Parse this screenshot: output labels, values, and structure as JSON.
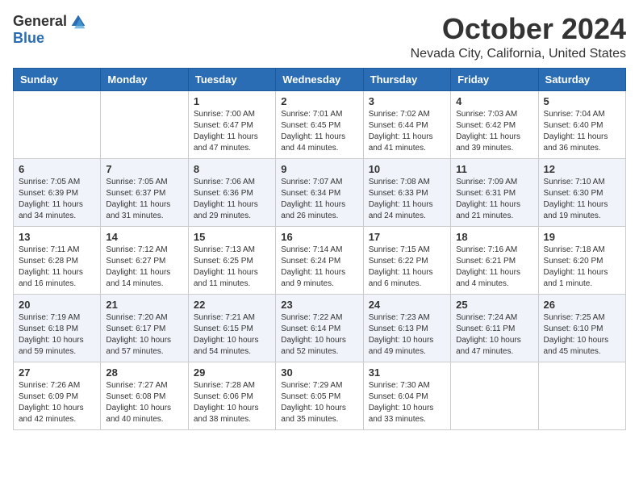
{
  "header": {
    "logo_general": "General",
    "logo_blue": "Blue",
    "month_title": "October 2024",
    "location": "Nevada City, California, United States"
  },
  "days_of_week": [
    "Sunday",
    "Monday",
    "Tuesday",
    "Wednesday",
    "Thursday",
    "Friday",
    "Saturday"
  ],
  "weeks": [
    [
      {
        "day": "",
        "info": ""
      },
      {
        "day": "",
        "info": ""
      },
      {
        "day": "1",
        "info": "Sunrise: 7:00 AM\nSunset: 6:47 PM\nDaylight: 11 hours and 47 minutes."
      },
      {
        "day": "2",
        "info": "Sunrise: 7:01 AM\nSunset: 6:45 PM\nDaylight: 11 hours and 44 minutes."
      },
      {
        "day": "3",
        "info": "Sunrise: 7:02 AM\nSunset: 6:44 PM\nDaylight: 11 hours and 41 minutes."
      },
      {
        "day": "4",
        "info": "Sunrise: 7:03 AM\nSunset: 6:42 PM\nDaylight: 11 hours and 39 minutes."
      },
      {
        "day": "5",
        "info": "Sunrise: 7:04 AM\nSunset: 6:40 PM\nDaylight: 11 hours and 36 minutes."
      }
    ],
    [
      {
        "day": "6",
        "info": "Sunrise: 7:05 AM\nSunset: 6:39 PM\nDaylight: 11 hours and 34 minutes."
      },
      {
        "day": "7",
        "info": "Sunrise: 7:05 AM\nSunset: 6:37 PM\nDaylight: 11 hours and 31 minutes."
      },
      {
        "day": "8",
        "info": "Sunrise: 7:06 AM\nSunset: 6:36 PM\nDaylight: 11 hours and 29 minutes."
      },
      {
        "day": "9",
        "info": "Sunrise: 7:07 AM\nSunset: 6:34 PM\nDaylight: 11 hours and 26 minutes."
      },
      {
        "day": "10",
        "info": "Sunrise: 7:08 AM\nSunset: 6:33 PM\nDaylight: 11 hours and 24 minutes."
      },
      {
        "day": "11",
        "info": "Sunrise: 7:09 AM\nSunset: 6:31 PM\nDaylight: 11 hours and 21 minutes."
      },
      {
        "day": "12",
        "info": "Sunrise: 7:10 AM\nSunset: 6:30 PM\nDaylight: 11 hours and 19 minutes."
      }
    ],
    [
      {
        "day": "13",
        "info": "Sunrise: 7:11 AM\nSunset: 6:28 PM\nDaylight: 11 hours and 16 minutes."
      },
      {
        "day": "14",
        "info": "Sunrise: 7:12 AM\nSunset: 6:27 PM\nDaylight: 11 hours and 14 minutes."
      },
      {
        "day": "15",
        "info": "Sunrise: 7:13 AM\nSunset: 6:25 PM\nDaylight: 11 hours and 11 minutes."
      },
      {
        "day": "16",
        "info": "Sunrise: 7:14 AM\nSunset: 6:24 PM\nDaylight: 11 hours and 9 minutes."
      },
      {
        "day": "17",
        "info": "Sunrise: 7:15 AM\nSunset: 6:22 PM\nDaylight: 11 hours and 6 minutes."
      },
      {
        "day": "18",
        "info": "Sunrise: 7:16 AM\nSunset: 6:21 PM\nDaylight: 11 hours and 4 minutes."
      },
      {
        "day": "19",
        "info": "Sunrise: 7:18 AM\nSunset: 6:20 PM\nDaylight: 11 hours and 1 minute."
      }
    ],
    [
      {
        "day": "20",
        "info": "Sunrise: 7:19 AM\nSunset: 6:18 PM\nDaylight: 10 hours and 59 minutes."
      },
      {
        "day": "21",
        "info": "Sunrise: 7:20 AM\nSunset: 6:17 PM\nDaylight: 10 hours and 57 minutes."
      },
      {
        "day": "22",
        "info": "Sunrise: 7:21 AM\nSunset: 6:15 PM\nDaylight: 10 hours and 54 minutes."
      },
      {
        "day": "23",
        "info": "Sunrise: 7:22 AM\nSunset: 6:14 PM\nDaylight: 10 hours and 52 minutes."
      },
      {
        "day": "24",
        "info": "Sunrise: 7:23 AM\nSunset: 6:13 PM\nDaylight: 10 hours and 49 minutes."
      },
      {
        "day": "25",
        "info": "Sunrise: 7:24 AM\nSunset: 6:11 PM\nDaylight: 10 hours and 47 minutes."
      },
      {
        "day": "26",
        "info": "Sunrise: 7:25 AM\nSunset: 6:10 PM\nDaylight: 10 hours and 45 minutes."
      }
    ],
    [
      {
        "day": "27",
        "info": "Sunrise: 7:26 AM\nSunset: 6:09 PM\nDaylight: 10 hours and 42 minutes."
      },
      {
        "day": "28",
        "info": "Sunrise: 7:27 AM\nSunset: 6:08 PM\nDaylight: 10 hours and 40 minutes."
      },
      {
        "day": "29",
        "info": "Sunrise: 7:28 AM\nSunset: 6:06 PM\nDaylight: 10 hours and 38 minutes."
      },
      {
        "day": "30",
        "info": "Sunrise: 7:29 AM\nSunset: 6:05 PM\nDaylight: 10 hours and 35 minutes."
      },
      {
        "day": "31",
        "info": "Sunrise: 7:30 AM\nSunset: 6:04 PM\nDaylight: 10 hours and 33 minutes."
      },
      {
        "day": "",
        "info": ""
      },
      {
        "day": "",
        "info": ""
      }
    ]
  ]
}
